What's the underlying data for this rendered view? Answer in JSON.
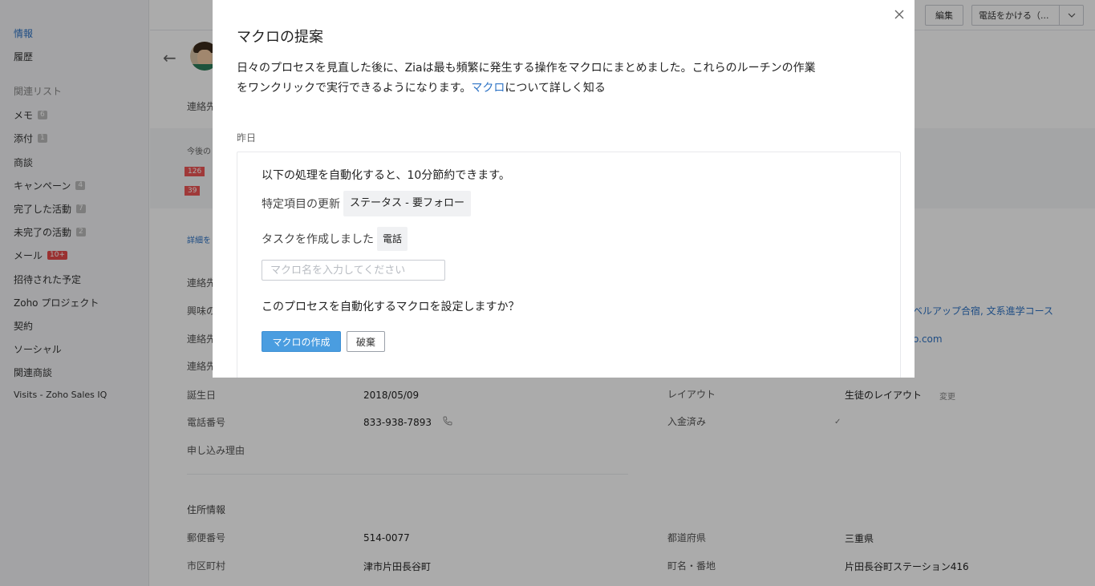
{
  "sidebar": {
    "items": [
      {
        "label": "情報",
        "active": true
      },
      {
        "label": "履歴"
      }
    ],
    "related_heading": "関連リスト",
    "related": [
      {
        "label": "メモ",
        "badge": "6"
      },
      {
        "label": "添付",
        "badge": "1"
      },
      {
        "label": "商談"
      },
      {
        "label": "キャンペーン",
        "badge": "4"
      },
      {
        "label": "完了した活動",
        "badge": "7"
      },
      {
        "label": "未完了の活動",
        "badge": "2"
      },
      {
        "label": "メール",
        "badge": "10+",
        "badge_color": "#e64a4a"
      },
      {
        "label": "招待された予定"
      },
      {
        "label": "Zoho プロジェクト"
      },
      {
        "label": "契約"
      },
      {
        "label": "ソーシャル"
      },
      {
        "label": "関連商談"
      },
      {
        "label": "Visits - Zoho Sales IQ"
      }
    ]
  },
  "topbar": {
    "edit_label": "編集",
    "call_label": "電話をかける（..."
  },
  "record": {
    "section_label_1": "連絡先",
    "band_label": "今後の",
    "band_tags": [
      "126",
      "39"
    ],
    "details_link": "詳細を",
    "section_label_2": "連絡先",
    "interest_label": "興味の",
    "interest_value": "ベルアップ合宿, 文系進学コース",
    "email_label": "連絡先",
    "email_value": "o.com",
    "owner_label": "連絡先",
    "birthday_label": "誕生日",
    "birthday_value": "2018/05/09",
    "layout_label": "レイアウト",
    "layout_value": "生徒のレイアウト",
    "layout_change": "変更",
    "phone_label": "電話番号",
    "phone_value": "833-938-7893",
    "paid_label": "入金済み",
    "reason_label": "申し込み理由",
    "address_heading": "住所情報",
    "zip_label": "郵便番号",
    "zip_value": "514-0077",
    "pref_label": "都道府県",
    "pref_value": "三重県",
    "city_label": "市区町村",
    "city_value": "津市片田長谷町",
    "street_label": "町名・番地",
    "street_value": "片田長谷町ステーション416"
  },
  "modal": {
    "title": "マクロの提案",
    "desc_line1": "日々のプロセスを見直した後に、Ziaは最も頻繁に発生する操作をマクロにまとめました。これらのルーチンの作業",
    "desc_line2_prefix": "をワンクリックで実行できるようになります。",
    "desc_link": "マクロ",
    "desc_line2_suffix": "について詳しく知る",
    "group_label": "昨日",
    "card": {
      "savings_text": "以下の処理を自動化すると、10分節約できます。",
      "action1_label": "特定項目の更新",
      "action1_chip": "ステータス - 要フォロー",
      "action2_label": "タスクを作成しました",
      "action2_chip": "電話",
      "name_placeholder": "マクロ名を入力してください",
      "question": "このプロセスを自動化するマクロを設定しますか？",
      "create_label": "マクロの作成",
      "discard_label": "破棄"
    }
  }
}
